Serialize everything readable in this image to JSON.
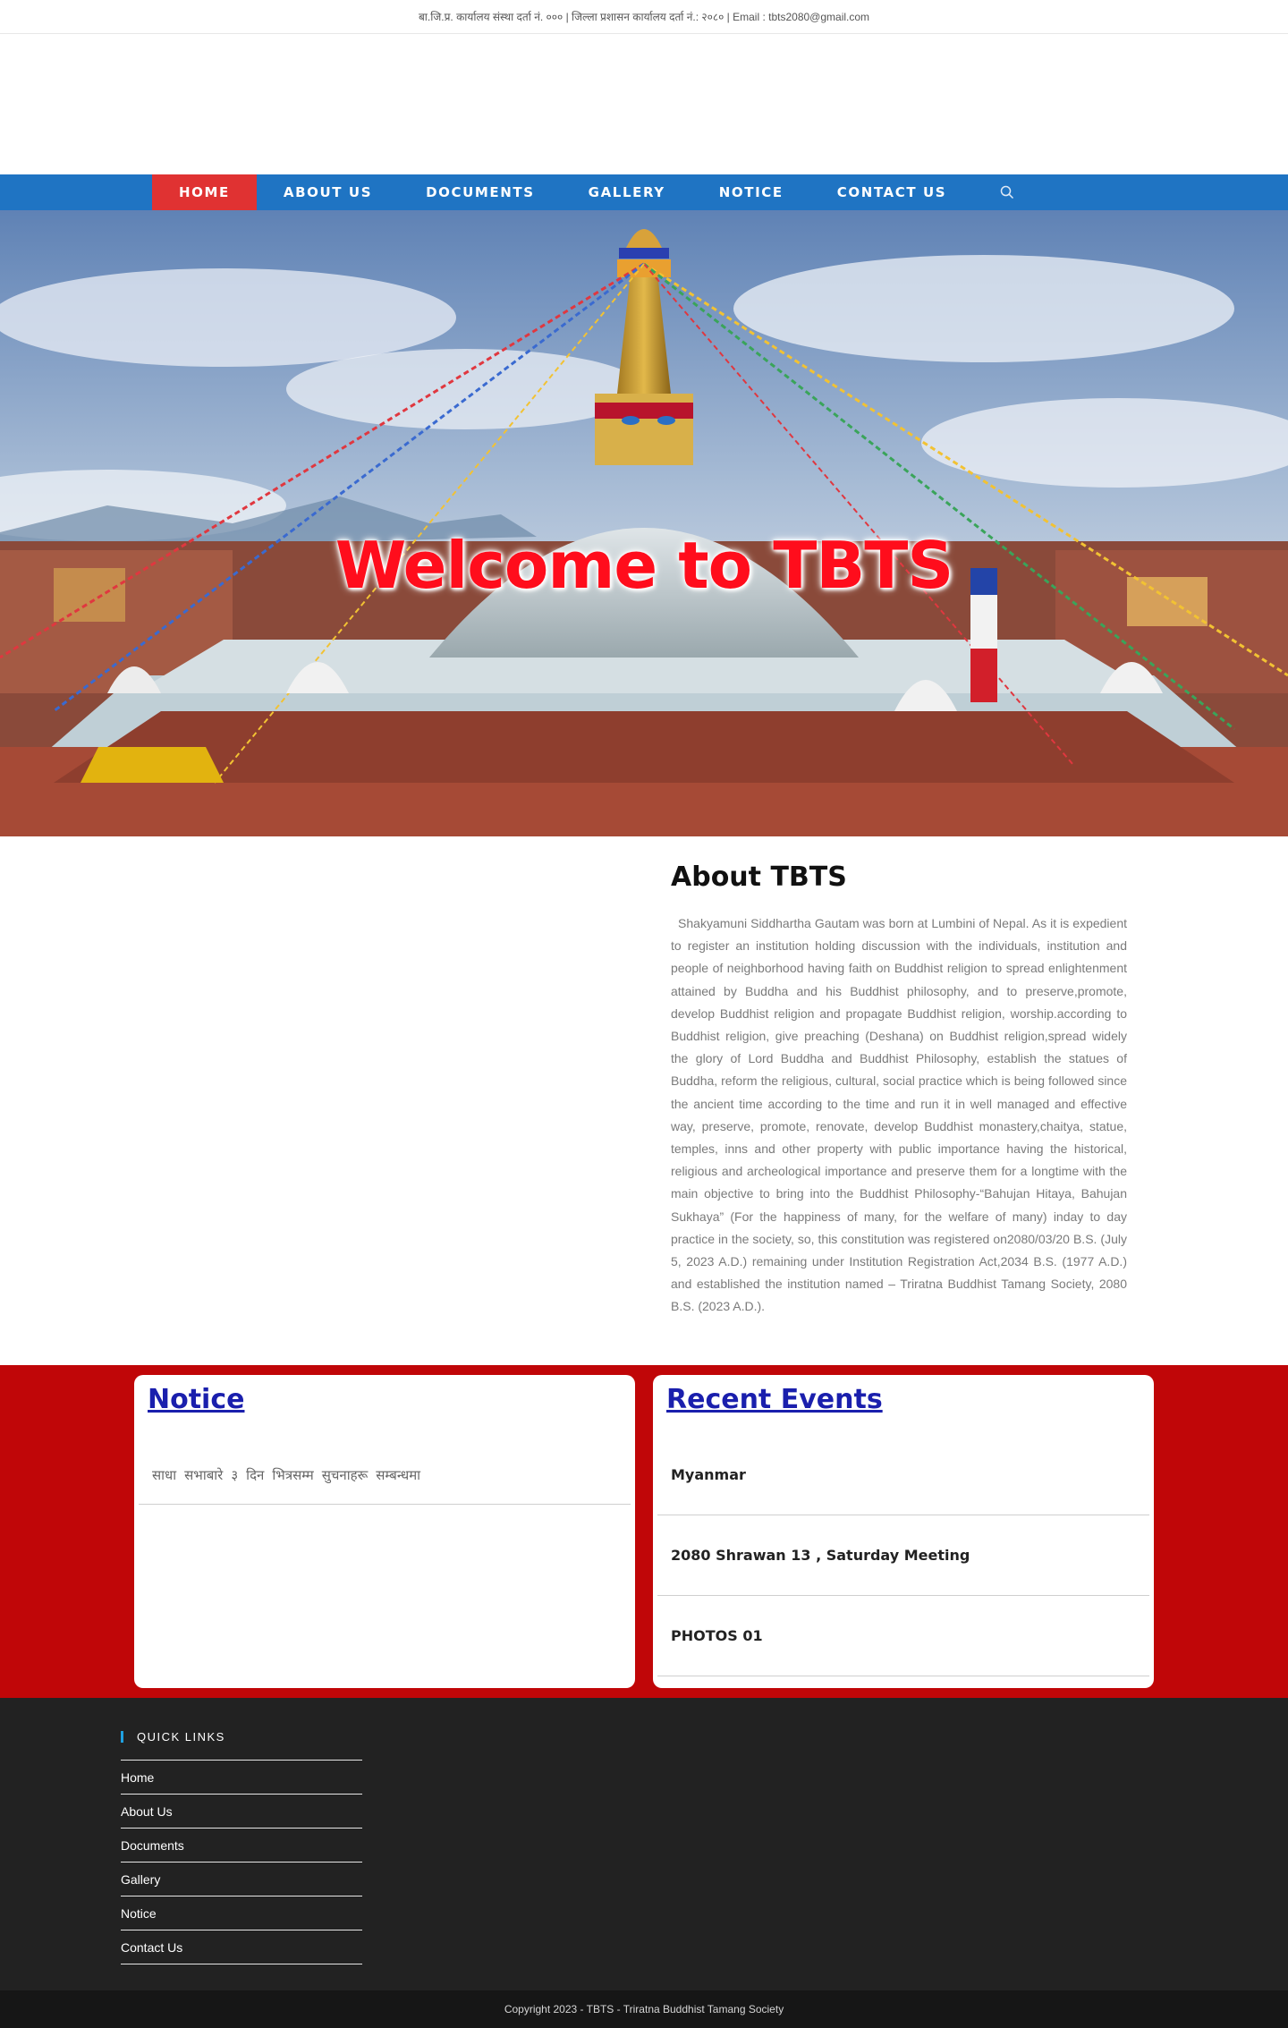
{
  "topbar": {
    "text": "बा.जि.प्र. कार्यालय संस्था दर्ता नं. ००० | जिल्ला प्रशासन कार्यालय दर्ता नं.: २०८० | Email : tbts2080@gmail.com"
  },
  "nav": {
    "items": [
      "HOME",
      "ABOUT US",
      "DOCUMENTS",
      "GALLERY",
      "NOTICE",
      "CONTACT US"
    ],
    "search_icon": "search-icon"
  },
  "hero": {
    "title": "Welcome to TBTS"
  },
  "about": {
    "title": "About TBTS",
    "text": "  Shakyamuni Siddhartha Gautam was born at Lumbini of Nepal. As it is expedient to register an institution holding discussion with the individuals, institution and people of neighborhood having faith on Buddhist religion to spread enlightenment attained by Buddha and his Buddhist philosophy, and to preserve,promote, develop Buddhist religion and propagate Buddhist religion, worship.according to Buddhist religion, give preaching (Deshana) on Buddhist religion,spread widely the glory of Lord Buddha and Buddhist Philosophy, establish the statues of Buddha, reform the religious, cultural, social practice which is being followed since the ancient time according to the time and run it in well managed and effective way, preserve, promote, renovate, develop Buddhist monastery,chaitya, statue, temples, inns and other property with public importance having the historical, religious and archeological importance and preserve them for a longtime with the main objective to bring into the Buddhist Philosophy-“Bahujan Hitaya, Bahujan Sukhaya” (For the happiness of many, for the welfare of many) inday to day practice in the society, so, this constitution was registered on2080/03/20 B.S. (July 5, 2023 A.D.) remaining under Institution Registration Act,2034 B.S. (1977 A.D.) and established the institution named – Triratna Buddhist Tamang Society, 2080 B.S. (2023 A.D.)."
  },
  "notice": {
    "title": "Notice",
    "items": [
      "साधा सभाबारे ३ दिन भित्रसम्म सुचनाहरू सम्बन्धमा"
    ]
  },
  "events": {
    "title": "Recent Events",
    "items": [
      "Myanmar",
      "2080 Shrawan 13 , Saturday Meeting",
      "PHOTOS 01"
    ]
  },
  "footer": {
    "quick_links_title": "QUICK LINKS",
    "links": [
      "Home",
      "About Us",
      "Documents",
      "Gallery",
      "Notice",
      "Contact Us"
    ],
    "copyright": "Copyright 2023 - TBTS - Triratna Buddhist Tamang Society"
  },
  "colors": {
    "nav_blue": "#1f74c3",
    "active_red": "#e03232",
    "band_red": "#c00608",
    "panel_title_blue": "#1a1fad",
    "footer_dark": "#222222"
  }
}
